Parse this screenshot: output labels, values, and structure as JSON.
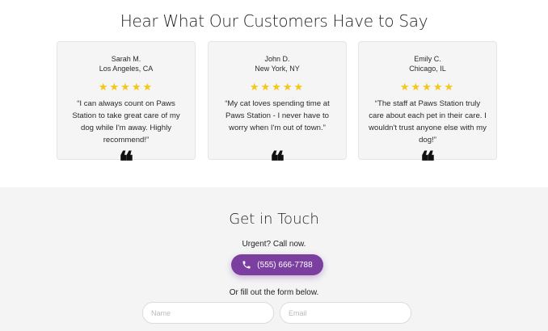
{
  "testimonials": {
    "title": "Hear What Our Customers Have to Say",
    "stars": "★★★★★",
    "quote_mark": "❝",
    "items": [
      {
        "name": "Sarah M.",
        "location": "Los Angeles, CA",
        "rating": 5,
        "quote": "“I can always count on Paws Station to take great care of my dog while I'm away. Highly recommend!”"
      },
      {
        "name": "John D.",
        "location": "New York, NY",
        "rating": 5,
        "quote": "“My cat loves spending time at Paws Station - I never have to worry when I'm out of town.”"
      },
      {
        "name": "Emily C.",
        "location": "Chicago, IL",
        "rating": 5,
        "quote": "“The staff at Paws Station truly care about each pet in their care. I wouldn't trust anyone else with my dog!”"
      }
    ]
  },
  "contact": {
    "title": "Get in Touch",
    "urgent_text": "Urgent? Call now.",
    "call_button_label": "(555) 666-7788",
    "call_icon": "phone-icon",
    "form_text": "Or fill out the form below.",
    "name_placeholder": "Name",
    "email_placeholder": "Email"
  },
  "colors": {
    "accent": "#7b3fa0",
    "star": "#f5c518",
    "card_bg": "#f5f5f5",
    "contact_bg": "#f4f4f4"
  }
}
